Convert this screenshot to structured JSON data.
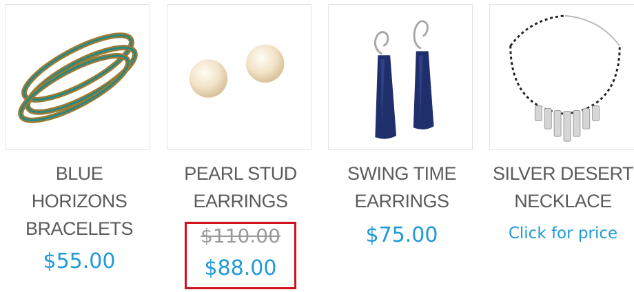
{
  "products": [
    {
      "name": "BLUE\nHORIZONS\nBRACELETS",
      "price": "$55.00",
      "image_icon": "bangle-bracelets-image"
    },
    {
      "name": "PEARL STUD\nEARRINGS",
      "old_price": "$110.00",
      "price": "$88.00",
      "image_icon": "pearl-earrings-image"
    },
    {
      "name": "SWING TIME\nEARRINGS",
      "price": "$75.00",
      "image_icon": "navy-drop-earrings-image"
    },
    {
      "name": "SILVER DESERT\nNECKLACE",
      "price_cta": "Click for price",
      "image_icon": "silver-necklace-image"
    }
  ],
  "colors": {
    "price": "#1f9ad6",
    "name": "#5b5b5b",
    "old_price": "#9a9a9a",
    "highlight": "#d0101a"
  }
}
